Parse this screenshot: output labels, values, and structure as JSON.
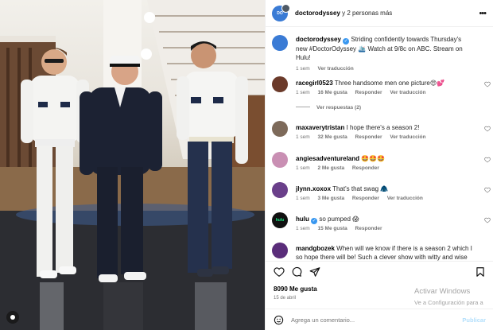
{
  "header": {
    "username": "doctorodyssey",
    "others": "y 2 personas más"
  },
  "caption": {
    "username": "doctorodyssey",
    "text": "Striding confidently towards Thursday's new #DoctorOdyssey 🛳️ Watch at 9/8c on ABC. Stream on Hulu!",
    "time": "1 sem",
    "translate": "Ver traducción"
  },
  "comments": [
    {
      "username": "racegirl0523",
      "text": "Three handsome men one picture😍💕",
      "time": "1 sem",
      "likes": "16 Me gusta",
      "reply": "Responder",
      "translate": "Ver traducción",
      "replies": "Ver respuestas (2)",
      "avatar_color": "#6b3a2a"
    },
    {
      "username": "maxaverytristan",
      "text": "I hope there's a season 2!",
      "time": "1 sem",
      "likes": "32 Me gusta",
      "reply": "Responder",
      "translate": "Ver traducción",
      "avatar_color": "#7d6a5a"
    },
    {
      "username": "angiesadventureland",
      "text": "🤩🤩🤩",
      "time": "1 sem",
      "likes": "2 Me gusta",
      "reply": "Responder",
      "avatar_color": "#c98fb3"
    },
    {
      "username": "jlynn.xoxox",
      "text": "That's that swag 🧥",
      "time": "1 sem",
      "likes": "3 Me gusta",
      "reply": "Responder",
      "translate": "Ver traducción",
      "avatar_color": "#6a3f8a"
    },
    {
      "username": "hulu",
      "text": "so pumped 😱",
      "time": "1 sem",
      "likes": "15 Me gusta",
      "reply": "Responder",
      "avatar_color": "#111111"
    },
    {
      "username": "mandgbozek",
      "text": "When will we know if there is a season 2 which I so hope there will be! Such a clever show with witty and wise",
      "avatar_color": "#5a2d7a"
    }
  ],
  "footer": {
    "likes": "8090 Me gusta",
    "date": "15 de abril",
    "comment_placeholder": "Agrega un comentario...",
    "post_label": "Publicar"
  },
  "watermark": {
    "line1": "Activar Windows",
    "line2": "Ve a Configuración para a"
  },
  "brand": {
    "hulu_label": "hulu"
  },
  "colors": {
    "verified": "#3897f0",
    "link": "#00376b",
    "muted": "#737373"
  }
}
